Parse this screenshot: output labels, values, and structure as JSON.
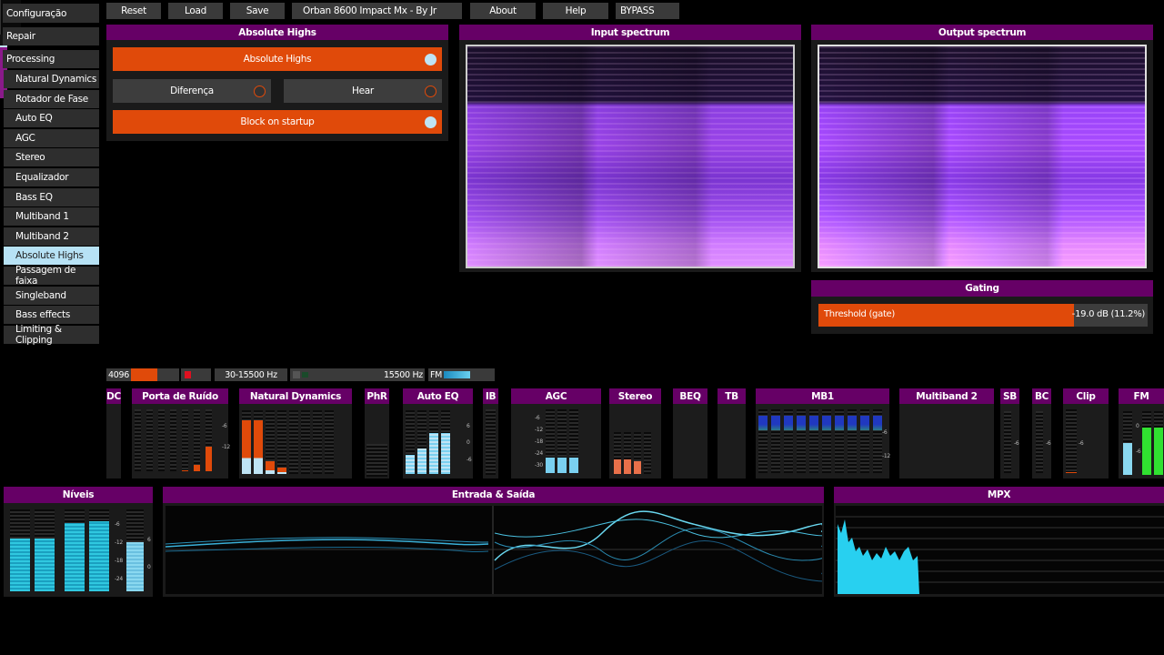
{
  "toolbar": {
    "reset": "Reset",
    "load": "Load",
    "save": "Save",
    "preset": "Orban 8600 Impact Mx  - By Jr",
    "about": "About",
    "help": "Help",
    "bypass": "BYPASS"
  },
  "sidebar": {
    "top": [
      "Configuração",
      "Repair",
      "Processing"
    ],
    "items": [
      "Natural Dynamics",
      "Rotador de Fase",
      "Auto EQ",
      "AGC",
      "Stereo",
      "Equalizador",
      "Bass EQ",
      "Multiband 1",
      "Multiband 2",
      "Absolute Highs",
      "Passagem de faixa",
      "Singleband",
      "Bass effects",
      "Limiting & Clipping"
    ],
    "active": "Absolute Highs"
  },
  "absolute_highs": {
    "title": "Absolute Highs",
    "enable": {
      "label": "Absolute Highs",
      "on": true
    },
    "diferenca": {
      "label": "Diferença",
      "on": false
    },
    "hear": {
      "label": "Hear",
      "on": false
    },
    "block": {
      "label": "Block on startup",
      "on": true
    }
  },
  "input_spectrum": {
    "title": "Input spectrum"
  },
  "output_spectrum": {
    "title": "Output spectrum"
  },
  "gating": {
    "title": "Gating",
    "threshold_label": "Threshold (gate)",
    "threshold_value": "-19.0 dB (11.2%)",
    "threshold_fraction": 0.775
  },
  "status": {
    "fft": "4096",
    "fft_fraction": 0.55,
    "range": "30-15500 Hz",
    "freq": "15500 Hz",
    "fm": "FM",
    "fm_fraction": 0.65
  },
  "modules": [
    "DC",
    "Porta de Ruído",
    "Natural Dynamics",
    "PhR",
    "Auto EQ",
    "IB",
    "AGC",
    "Stereo",
    "BEQ",
    "TB",
    "MB1",
    "Multiband 2",
    "SB",
    "BC",
    "Clip",
    "FM"
  ],
  "ticks": {
    "porta": [
      "-6",
      "-12"
    ],
    "autoeq": [
      "6",
      "0",
      "-6"
    ],
    "agc": [
      "-6",
      "-12",
      "-18",
      "-24",
      "-30"
    ],
    "mb1": [
      "-6",
      "-12"
    ],
    "sb": "-6",
    "bc": "-6",
    "clip": "-6",
    "fm": [
      "0",
      "-6"
    ],
    "niveis": [
      "-6",
      "-12",
      "-18",
      "-24"
    ],
    "niveis_r": [
      "6",
      "0"
    ]
  },
  "bottom": {
    "niveis": "Níveis",
    "entrada": "Entrada & Saída",
    "mpx": "MPX"
  },
  "levels": {
    "niveis": [
      0.65,
      0.64,
      0.83,
      0.86,
      0.6
    ],
    "natural_dynamics": [
      0.85,
      0.85,
      0.2,
      0.1
    ],
    "autoeq": [
      0.3,
      0.4,
      0.65,
      0.65
    ],
    "fm": [
      0.5,
      0.75,
      0.75
    ]
  }
}
